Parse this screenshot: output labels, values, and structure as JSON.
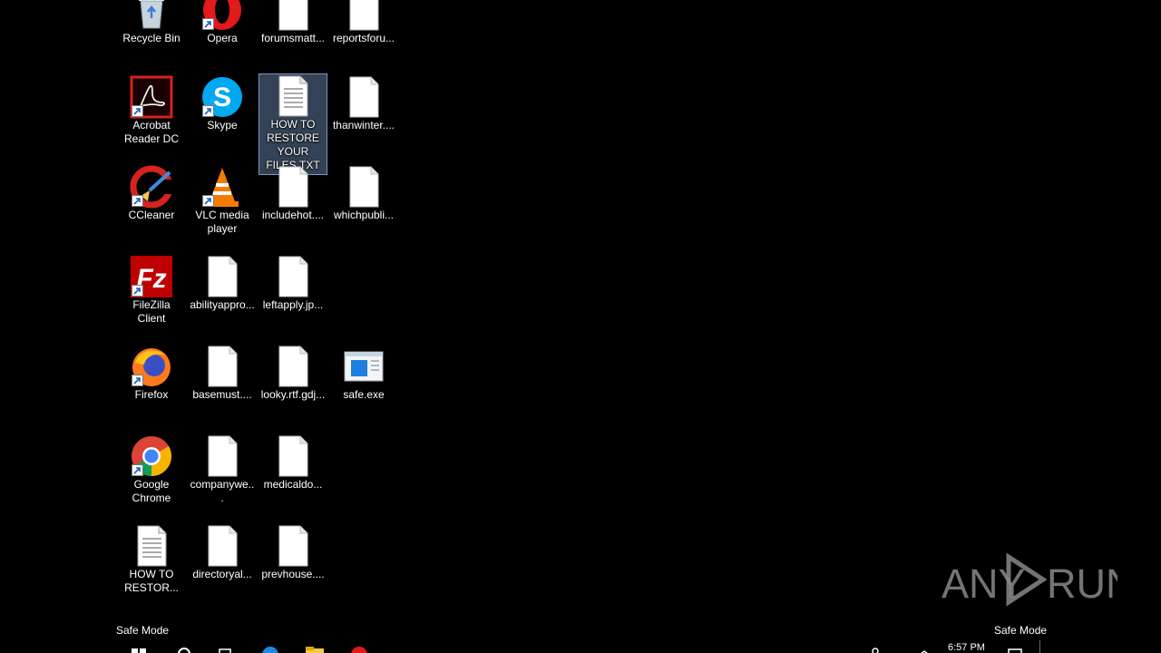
{
  "desktop": {
    "icons": [
      {
        "label": "Recycle Bin"
      },
      {
        "label": "Opera"
      },
      {
        "label": "forumsmatt..."
      },
      {
        "label": "reportsforu..."
      },
      {
        "label": "Acrobat Reader DC"
      },
      {
        "label": "Skype"
      },
      {
        "label": "HOW TO RESTORE YOUR FILES.TXT"
      },
      {
        "label": "thanwinter...."
      },
      {
        "label": "CCleaner"
      },
      {
        "label": "VLC media player"
      },
      {
        "label": "includehot...."
      },
      {
        "label": "whichpubli..."
      },
      {
        "label": "FileZilla Client"
      },
      {
        "label": "abilityappro..."
      },
      {
        "label": "leftapply.jp..."
      },
      {
        "label": "Firefox"
      },
      {
        "label": "basemust...."
      },
      {
        "label": "looky.rtf.gdj..."
      },
      {
        "label": "safe.exe"
      },
      {
        "label": "Google Chrome"
      },
      {
        "label": "companywe..."
      },
      {
        "label": "medicaldo..."
      },
      {
        "label": "HOW TO RESTOR..."
      },
      {
        "label": "directoryal..."
      },
      {
        "label": "prevhouse...."
      }
    ]
  },
  "safe_mode_label": "Safe Mode",
  "watermark": {
    "left": "ANY",
    "right": "RUN"
  },
  "taskbar": {
    "clock": "6:57 PM"
  },
  "colors": {
    "desktop_bg": "#000000",
    "selection": "#7092be"
  }
}
